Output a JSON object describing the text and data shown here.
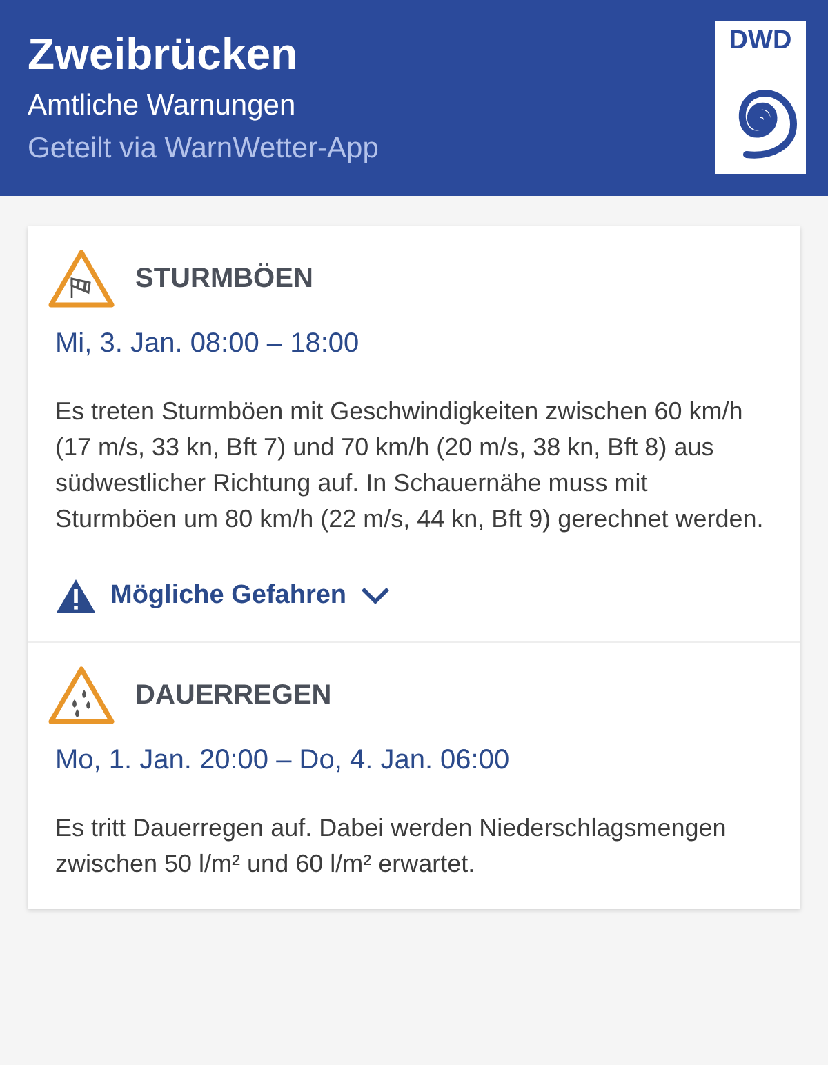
{
  "header": {
    "title": "Zweibrücken",
    "subtitle": "Amtliche Warnungen",
    "shared": "Geteilt via WarnWetter-App",
    "logo": "DWD"
  },
  "warnings": [
    {
      "kind": "wind",
      "title": "STURMBÖEN",
      "period": "Mi, 3. Jan. 08:00 – 18:00",
      "text": "Es treten Sturmböen mit Geschwindigkeiten zwischen 60 km/h (17 m/s, 33 kn, Bft 7) und 70 km/h (20 m/s, 38 kn, Bft 8) aus südwestlicher Richtung auf. In Schauernähe muss mit Sturmböen um 80 km/h (22 m/s, 44 kn, Bft 9) gerechnet werden.",
      "dangers": {
        "label": "Mögliche Gefahren",
        "expanded": false
      }
    },
    {
      "kind": "rain",
      "title": "DAUERREGEN",
      "period": "Mo, 1. Jan. 20:00 – Do, 4. Jan. 06:00",
      "text": "Es tritt Dauerregen auf. Dabei werden Niederschlagsmengen zwischen 50 l/m² und 60 l/m² erwartet."
    }
  ]
}
